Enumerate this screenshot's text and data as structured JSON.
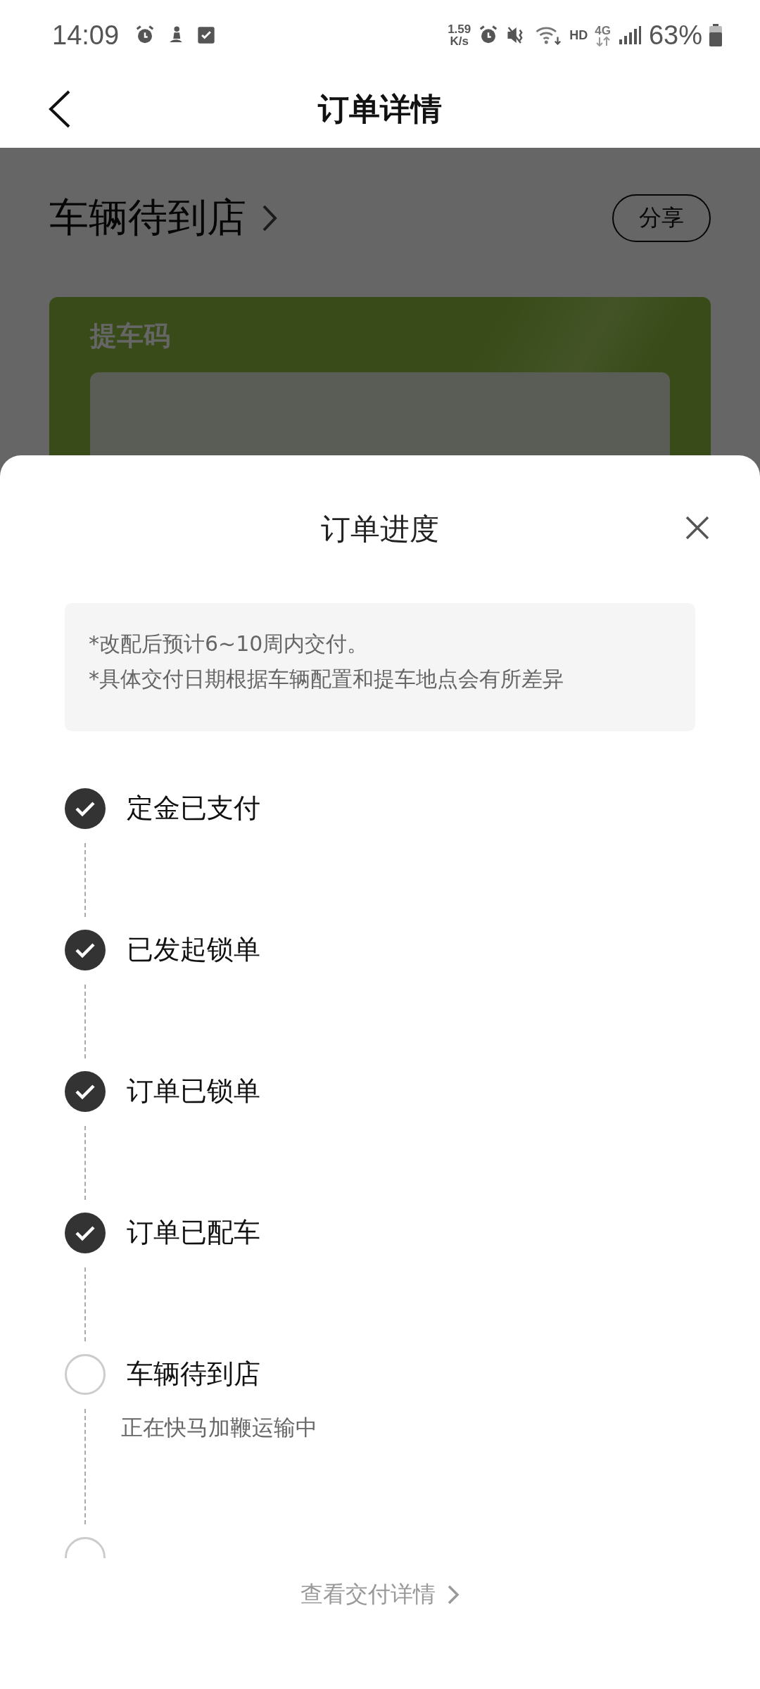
{
  "status_bar": {
    "time": "14:09",
    "speed": "1.59",
    "speed_unit": "K/s",
    "hd": "HD",
    "network": "4G",
    "battery": "63%"
  },
  "header": {
    "title": "订单详情"
  },
  "background": {
    "status_title": "车辆待到店",
    "share": "分享",
    "card_title": "提车码"
  },
  "sheet": {
    "title": "订单进度",
    "notes": [
      "*改配后预计6~10周内交付。",
      "*具体交付日期根据车辆配置和提车地点会有所差异"
    ],
    "steps": [
      {
        "label": "定金已支付",
        "done": true
      },
      {
        "label": "已发起锁单",
        "done": true
      },
      {
        "label": "订单已锁单",
        "done": true
      },
      {
        "label": "订单已配车",
        "done": true
      },
      {
        "label": "车辆待到店",
        "done": false,
        "detail": "正在快马加鞭运输中"
      },
      {
        "done": false
      }
    ],
    "footer_link": "查看交付详情"
  }
}
